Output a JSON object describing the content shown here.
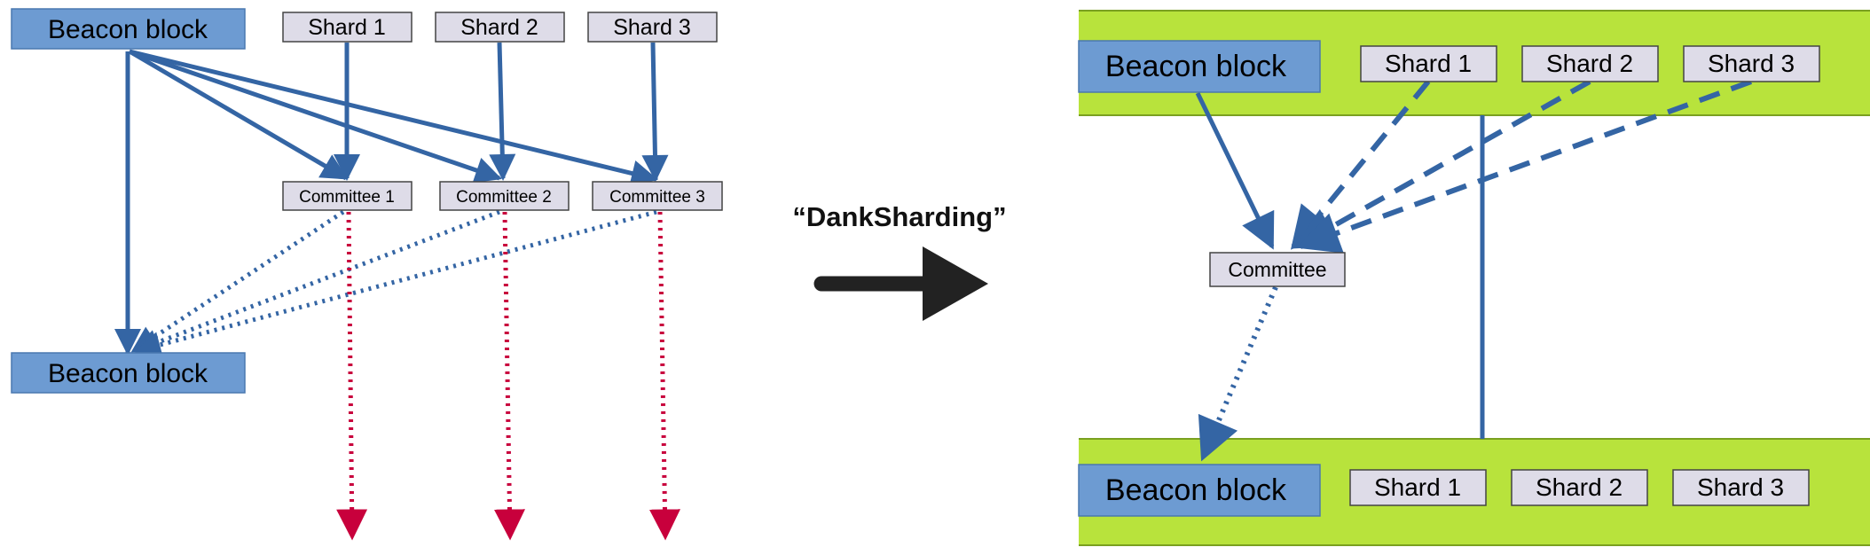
{
  "colors": {
    "beacon_fill": "#6d9bd2",
    "beacon_stroke": "#4a78b0",
    "shard_fill": "#dedce8",
    "shard_stroke": "#444444",
    "arrow_blue": "#3465a4",
    "arrow_red": "#c8003c",
    "band_green": "#b8e33c",
    "band_border": "#7aa020",
    "big_arrow": "#222222"
  },
  "left": {
    "beacon_top": "Beacon block",
    "beacon_bottom": "Beacon block",
    "shards": [
      "Shard 1",
      "Shard 2",
      "Shard 3"
    ],
    "committees": [
      "Committee 1",
      "Committee 2",
      "Committee 3"
    ]
  },
  "middle": {
    "label": "“DankSharding”"
  },
  "right": {
    "beacon_top": "Beacon block",
    "shards_top": [
      "Shard 1",
      "Shard 2",
      "Shard 3"
    ],
    "committee": "Committee",
    "beacon_bottom": "Beacon block",
    "shards_bottom": [
      "Shard 1",
      "Shard 2",
      "Shard 3"
    ]
  }
}
